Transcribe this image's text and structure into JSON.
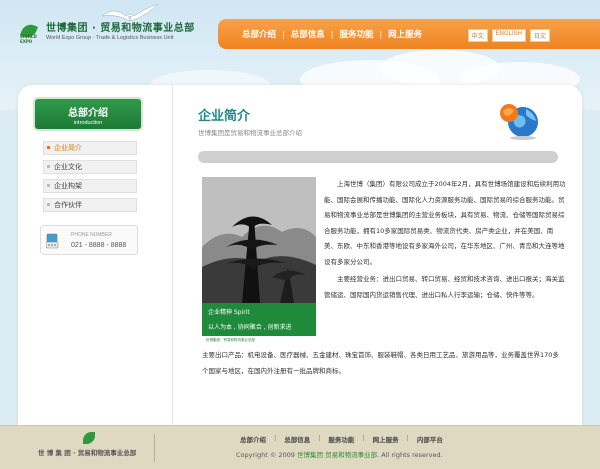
{
  "header": {
    "logo_cn": "世博集团 · 贸易和物流事业总部",
    "logo_en": "World Expo Group  ·  Trade & Logistics Business Unit",
    "logo_mark_text": "WORLD EXPO"
  },
  "nav": {
    "items": [
      "总部介绍",
      "总部信息",
      "服务功能",
      "网上服务"
    ],
    "languages": [
      "中文",
      "ENGLISH",
      "日文"
    ]
  },
  "sidebar": {
    "title_cn": "总部介绍",
    "title_en": "introduction",
    "items": [
      "企业简介",
      "企业文化",
      "企业构架",
      "合作伙伴"
    ],
    "phone_label": "PHONE NUMBER",
    "phone_number": "021 - 8888 - 8888"
  },
  "content": {
    "title": "企业简介",
    "subtitle": "世博集团是贸易和物流事业总部介绍",
    "poster": {
      "line1": "企业精神  Spirit",
      "line2": "以人为本 , 协同聚合 , 创新求进",
      "line3": "世博集团 · 贸易和物流事业总部"
    },
    "paragraph1": "上海世博（集团）有限公司成立于2004年2月，具有世博场馆建设和后续利用功能、国际会展和传播功能、国际化人力资源服务功能、国际贸易的综合服务功能。贸易和物流事业总部是世博集团的主营业务板块，具有贸易、物流、仓储等国际贸易综合服务功能，拥有10多家国际贸易类、物流货代类、房产类企业，并在美国、南美、东欧、中东和香港等地设有多家海外公司，在华东地区、广州、青岛和大连等地设有多家分公司。",
    "paragraph2_a": "主要经营业务：进出口贸易、转口贸易、经贸和技术咨询、进出口报关；海关监管储运、国际国内货运销售代理、进出口私人行李运输；仓储、快件等等。",
    "paragraph2_b": "主要出口产品：机电设备、医疗器械、五金建材、珠宝首饰、服装鞋帽、各类日用工艺品、旅游用品等，业务覆盖世界170多个国家与地区，在国内外注册有一批品牌和商标。"
  },
  "footer": {
    "logo_text": "世 博 集 团 · 贸易和物流事业总部",
    "nav": [
      "总部介绍",
      "总部信息",
      "服务功能",
      "网上服务",
      "内部平台"
    ],
    "copyright_pre": "Copyright © 2009",
    "copyright_name": "世博集团 贸易和物流事业部",
    "copyright_post": ". All rights reserved."
  },
  "colors": {
    "accent_orange": "#ef8420",
    "brand_green": "#1e7a36",
    "title_teal": "#1e8a8a"
  }
}
